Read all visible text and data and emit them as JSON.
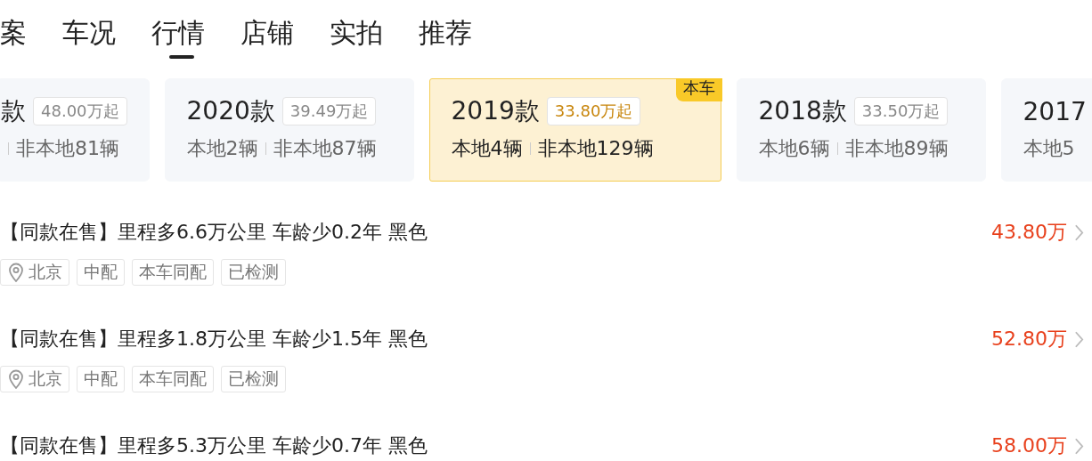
{
  "tabs": [
    {
      "label": "案",
      "selected": false
    },
    {
      "label": "车况",
      "selected": false
    },
    {
      "label": "行情",
      "selected": true
    },
    {
      "label": "店铺",
      "selected": false
    },
    {
      "label": "实拍",
      "selected": false
    },
    {
      "label": "推荐",
      "selected": false
    }
  ],
  "versions": [
    {
      "year": "款",
      "price": "48.00万起",
      "nonlocal": "非本地81辆",
      "selected": false
    },
    {
      "year": "2020款",
      "price": "39.49万起",
      "local": "本地2辆",
      "nonlocal": "非本地87辆",
      "selected": false
    },
    {
      "year": "2019款",
      "price": "33.80万起",
      "local": "本地4辆",
      "nonlocal": "非本地129辆",
      "selected": true,
      "badge": "本车"
    },
    {
      "year": "2018款",
      "price": "33.50万起",
      "local": "本地6辆",
      "nonlocal": "非本地89辆",
      "selected": false
    },
    {
      "year": "2017",
      "local": "本地5",
      "selected": false
    }
  ],
  "listings": [
    {
      "title": "【同款在售】里程多6.6万公里 车龄少0.2年 黑色",
      "price": "43.80万",
      "tags": [
        {
          "kind": "location",
          "text": "北京"
        },
        {
          "kind": "plain",
          "text": "中配"
        },
        {
          "kind": "plain",
          "text": "本车同配"
        },
        {
          "kind": "plain",
          "text": "已检测"
        }
      ]
    },
    {
      "title": "【同款在售】里程多1.8万公里 车龄少1.5年 黑色",
      "price": "52.80万",
      "tags": [
        {
          "kind": "location",
          "text": "北京"
        },
        {
          "kind": "plain",
          "text": "中配"
        },
        {
          "kind": "plain",
          "text": "本车同配"
        },
        {
          "kind": "plain",
          "text": "已检测"
        }
      ]
    },
    {
      "title": "【同款在售】里程多5.3万公里 车龄少0.7年 黑色",
      "price": "58.00万"
    }
  ]
}
